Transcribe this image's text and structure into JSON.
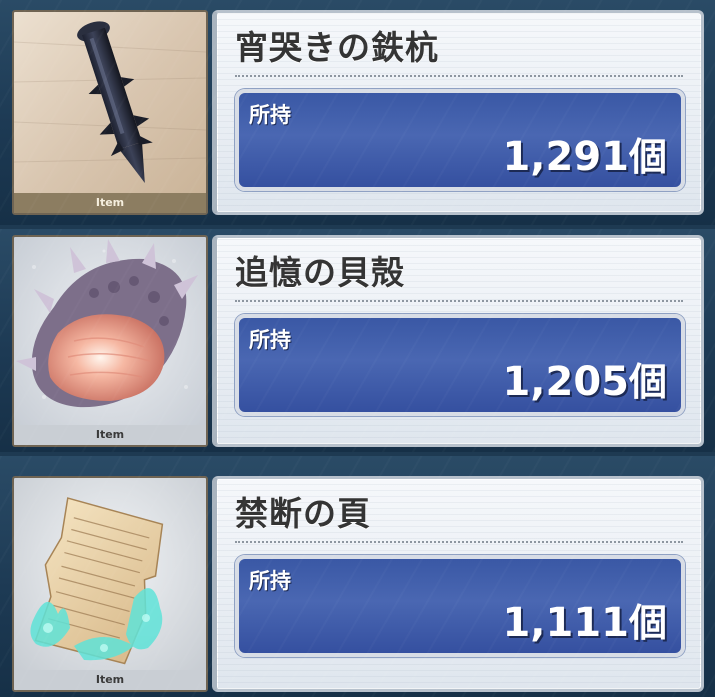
{
  "items": [
    {
      "name": "宵哭きの鉄杭",
      "tag": "Item",
      "label": "所持",
      "count": "1,291",
      "unit": "個",
      "icon": "iron-stake-icon"
    },
    {
      "name": "追憶の貝殻",
      "tag": "Item",
      "label": "所持",
      "count": "1,205",
      "unit": "個",
      "icon": "spiked-shell-icon"
    },
    {
      "name": "禁断の頁",
      "tag": "Item",
      "label": "所持",
      "count": "1,111",
      "unit": "個",
      "icon": "torn-page-icon"
    }
  ],
  "colors": {
    "count_box": "#4560ad",
    "panel": "#eef2f6",
    "frame_border": "#6f6453"
  }
}
